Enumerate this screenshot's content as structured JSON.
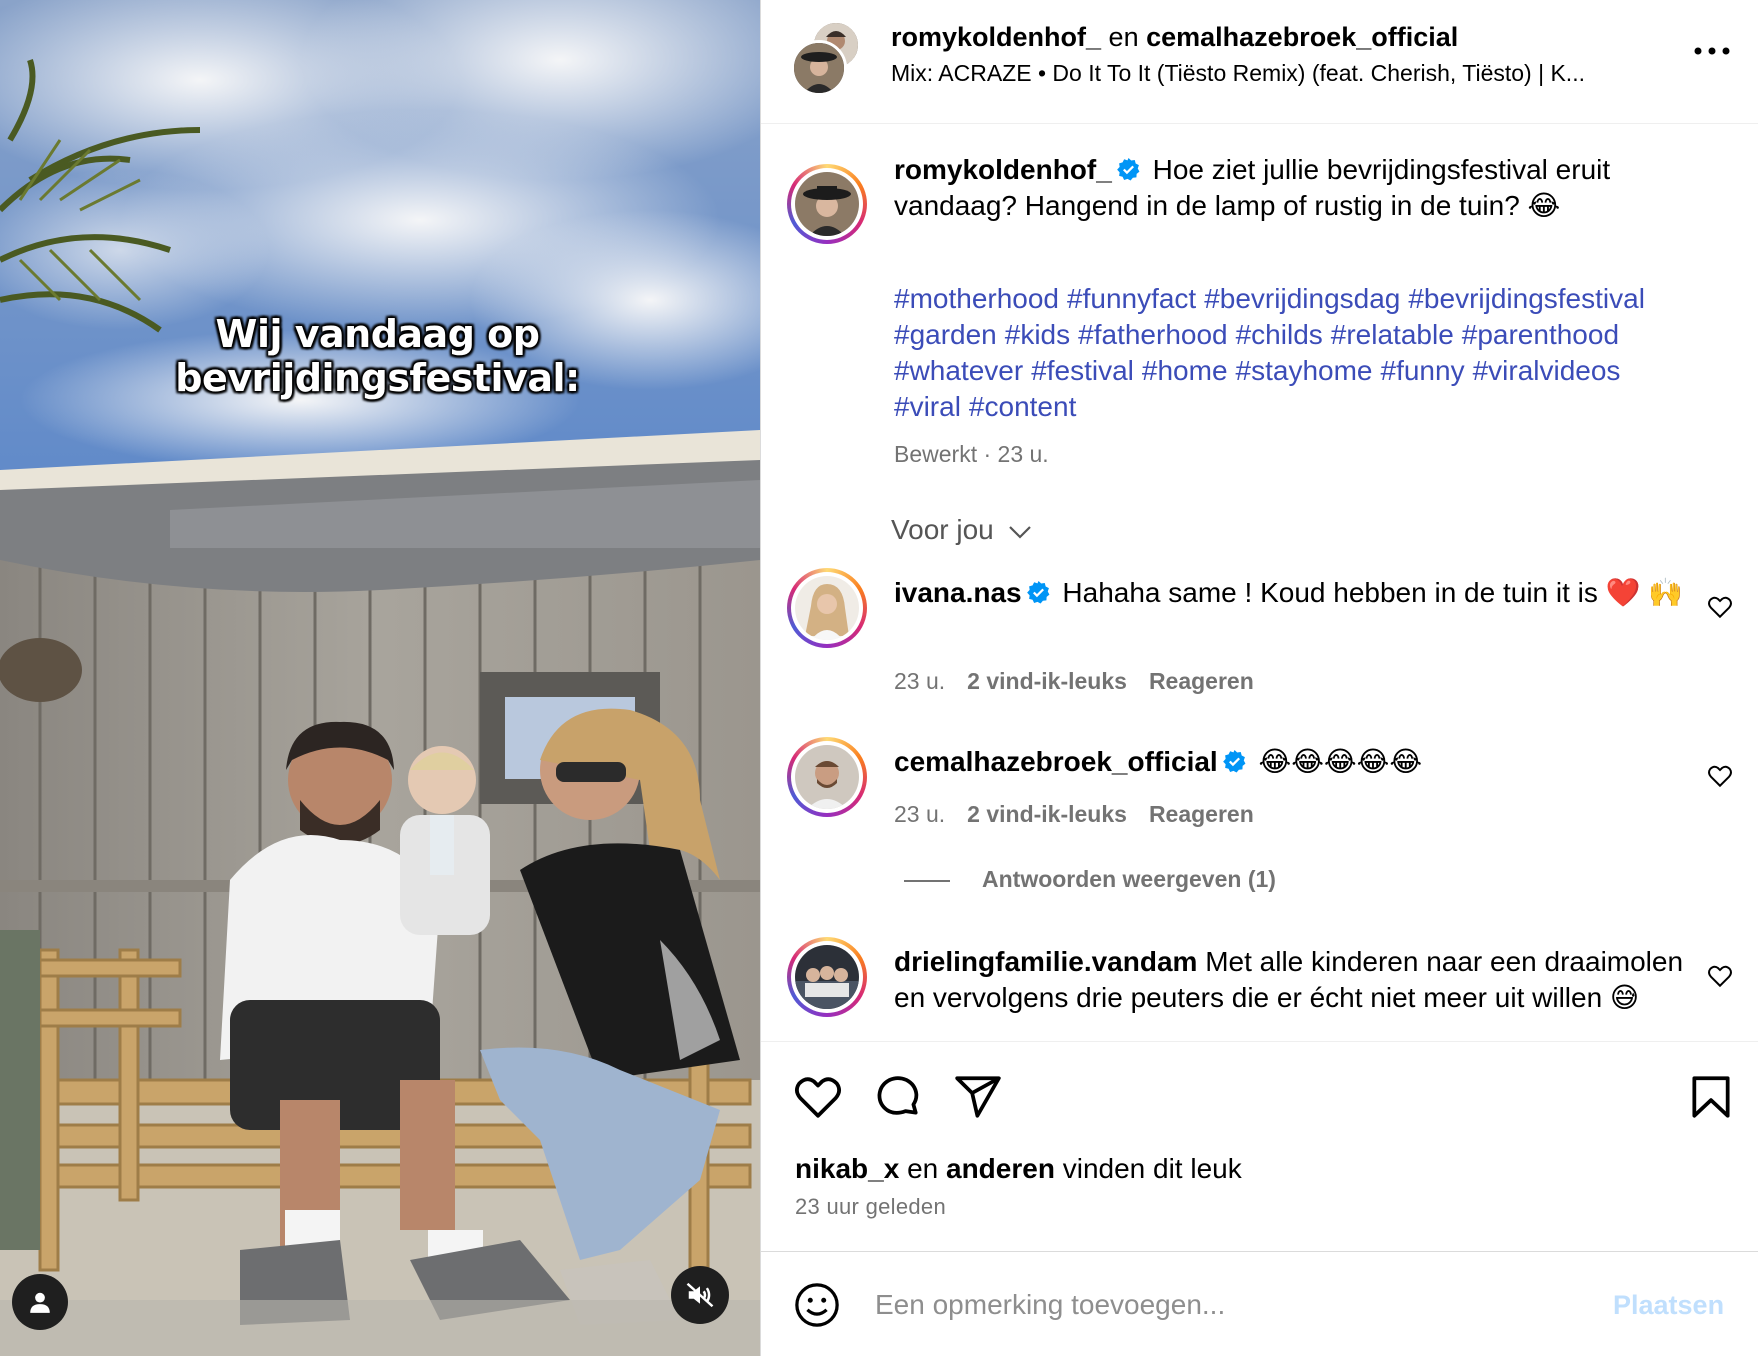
{
  "video": {
    "overlay_line1": "Wij vandaag op",
    "overlay_line2": "bevrijdingsfestival:",
    "tag_icon": "user-tag-icon",
    "mute_icon": "speaker-muted-icon"
  },
  "header": {
    "user1": "romykoldenhof_",
    "joiner": "en",
    "user2": "cemalhazebroek_official",
    "audio": "Mix: ACRAZE • Do It To It (Tiësto Remix) (feat. Cherish, Tiësto) | K..."
  },
  "caption": {
    "user": "romykoldenhof_",
    "text": "Hoe ziet jullie bevrijdingsfestival eruit vandaag? Hangend in de lamp of rustig in de tuin? 😂",
    "hashtags": [
      "#motherhood",
      "#funnyfact",
      "#bevrijdingsdag",
      "#bevrijdingsfestival",
      "#garden",
      "#kids",
      "#fatherhood",
      "#childs",
      "#relatable",
      "#parenthood",
      "#whatever",
      "#festival",
      "#home",
      "#stayhome",
      "#funny",
      "#viralvideos",
      "#viral",
      "#content"
    ],
    "meta": "Bewerkt · 23 u."
  },
  "sort": {
    "label": "Voor jou"
  },
  "comments": [
    {
      "user": "ivana.nas",
      "text": "Hahaha same ! Koud hebben in de tuin it is ❤️ 🙌",
      "time": "23 u.",
      "likes": "2 vind-ik-leuks",
      "reply": "Reageren"
    },
    {
      "user": "cemalhazebroek_official",
      "text": "😂😂😂😂😂",
      "time": "23 u.",
      "likes": "2 vind-ik-leuks",
      "reply": "Reageren",
      "view_replies": "Antwoorden weergeven (1)"
    },
    {
      "user": "drielingfamilie.vandam",
      "text": "Met alle kinderen naar een draaimolen en vervolgens drie peuters die er écht niet meer uit willen 😅"
    }
  ],
  "footer": {
    "liked_user": "nikab_x",
    "liked_and": "en",
    "liked_others": "anderen",
    "liked_suffix": "vinden dit leuk",
    "time": "23 uur geleden"
  },
  "add_comment": {
    "placeholder": "Een opmerking toevoegen...",
    "post_label": "Plaatsen"
  },
  "colors": {
    "hashtag": "#3b4cb8",
    "verified": "#0095f6",
    "secondary_text": "#737373",
    "post_disabled": "#c0dffd"
  }
}
